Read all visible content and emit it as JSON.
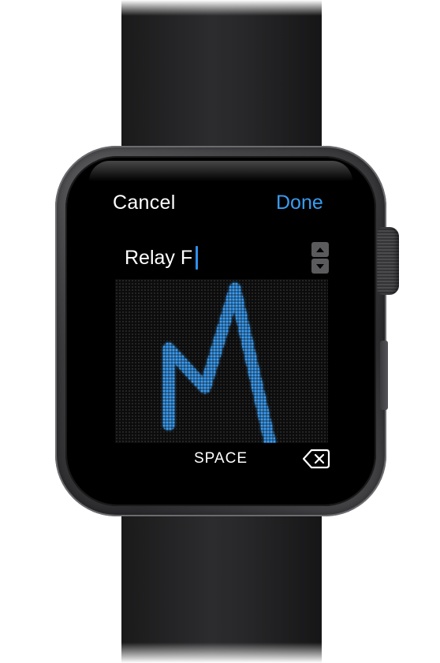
{
  "watch_ui": {
    "cancel_label": "Cancel",
    "done_label": "Done",
    "text_value": "Relay F",
    "space_label": "SPACE",
    "accent_color": "#3a9cf0",
    "scribble_stroke_color": "#2f8ff0"
  },
  "icons": {
    "stepper_up": "chevron-up-icon",
    "stepper_down": "chevron-down-icon",
    "delete": "backspace-icon"
  }
}
